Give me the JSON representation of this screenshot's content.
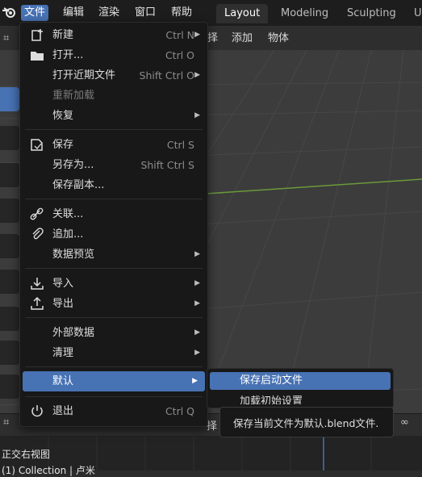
{
  "topbar": {
    "menus": [
      "文件",
      "编辑",
      "渲染",
      "窗口",
      "帮助"
    ],
    "workspaces": [
      "Layout",
      "Modeling",
      "Sculpting",
      "U"
    ]
  },
  "header2": {
    "items": [
      "择",
      "添加",
      "物体"
    ]
  },
  "file_menu": {
    "items": [
      {
        "label": "新建",
        "shortcut": "Ctrl N",
        "icon": "new-file-icon",
        "submenu": true
      },
      {
        "label": "打开...",
        "shortcut": "Ctrl O",
        "icon": "folder-icon"
      },
      {
        "label": "打开近期文件",
        "shortcut": "Shift Ctrl O",
        "submenu": true
      },
      {
        "label": "重新加载",
        "disabled": true
      },
      {
        "label": "恢复",
        "submenu": true
      },
      {
        "label": "保存",
        "shortcut": "Ctrl S",
        "icon": "save-icon"
      },
      {
        "label": "另存为...",
        "shortcut": "Shift Ctrl S"
      },
      {
        "label": "保存副本..."
      },
      {
        "label": "关联...",
        "icon": "link-icon"
      },
      {
        "label": "追加...",
        "icon": "append-icon"
      },
      {
        "label": "数据预览",
        "submenu": true
      },
      {
        "label": "导入",
        "icon": "import-icon",
        "submenu": true
      },
      {
        "label": "导出",
        "icon": "export-icon",
        "submenu": true
      },
      {
        "label": "外部数据",
        "submenu": true
      },
      {
        "label": "清理",
        "submenu": true
      },
      {
        "label": "默认",
        "submenu": true,
        "highlighted": true
      },
      {
        "label": "退出",
        "shortcut": "Ctrl Q",
        "icon": "quit-icon"
      }
    ]
  },
  "defaults_submenu": {
    "items": [
      "保存启动文件",
      "加载初始设置"
    ]
  },
  "tooltip": {
    "text": "保存当前文件为默认.blend文件."
  },
  "bottombar": {
    "partial_label": "择"
  },
  "viewport": {
    "view_name": "正交右视图",
    "collection": "(1) Collection | 卢米"
  },
  "colors": {
    "accent": "#4772b3",
    "menu_bg": "#181818",
    "grid_green": "#6a9a3a"
  }
}
